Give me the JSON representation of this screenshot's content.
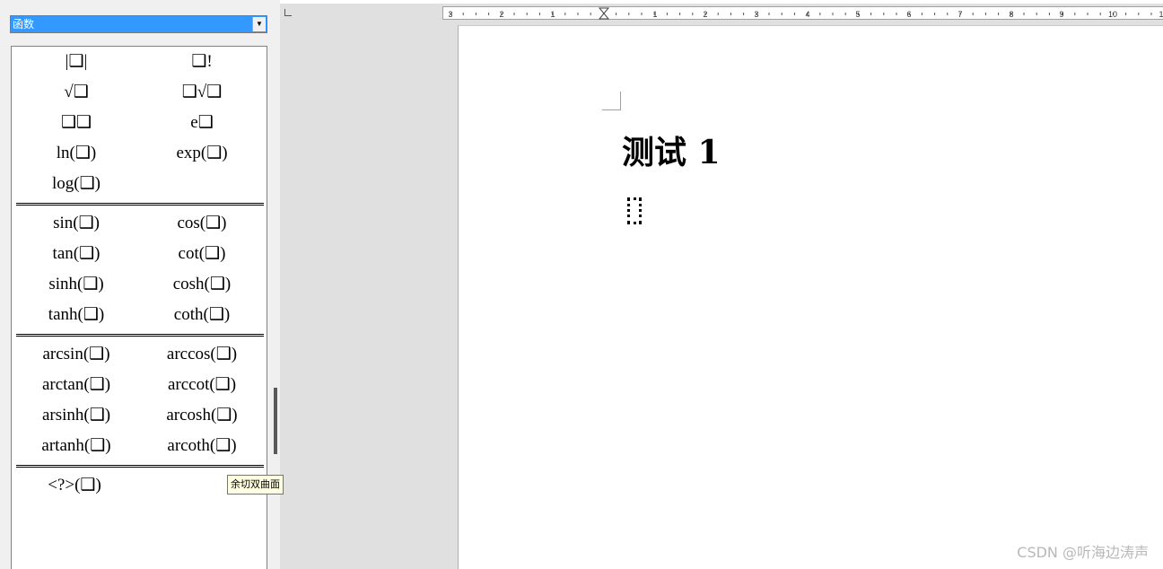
{
  "elements_panel": {
    "category_selected": "函数",
    "symbol_rows": [
      {
        "left": "|❑|",
        "right": "❑!"
      },
      {
        "left": "√❑",
        "right": "❑√❑"
      },
      {
        "left": "❑❑",
        "right": "e❑"
      },
      {
        "left": "ln(❑)",
        "right": "exp(❑)"
      },
      {
        "left": "log(❑)",
        "right": ""
      },
      {
        "left": "sin(❑)",
        "right": "cos(❑)"
      },
      {
        "left": "tan(❑)",
        "right": "cot(❑)"
      },
      {
        "left": "sinh(❑)",
        "right": "cosh(❑)"
      },
      {
        "left": "tanh(❑)",
        "right": "coth(❑)"
      },
      {
        "left": "arcsin(❑)",
        "right": "arccos(❑)"
      },
      {
        "left": "arctan(❑)",
        "right": "arccot(❑)"
      },
      {
        "left": "arsinh(❑)",
        "right": "arcosh(❑)"
      },
      {
        "left": "artanh(❑)",
        "right": "arcoth(❑)"
      },
      {
        "left": "<?>(❑)",
        "right": ""
      }
    ],
    "tooltip": "余切双曲面"
  },
  "ruler": {
    "labels": [
      "3",
      "2",
      "1",
      "1",
      "2",
      "3",
      "4",
      "5",
      "6",
      "7",
      "8",
      "9",
      "10",
      "1"
    ]
  },
  "document": {
    "heading": "测试 1"
  },
  "watermark": "CSDN @听海边涛声",
  "colors": {
    "selection": "#3399ff",
    "panel_bg": "#f0f0f0",
    "doc_bg": "#e0e0e0",
    "tooltip_bg": "#ffffe1"
  }
}
